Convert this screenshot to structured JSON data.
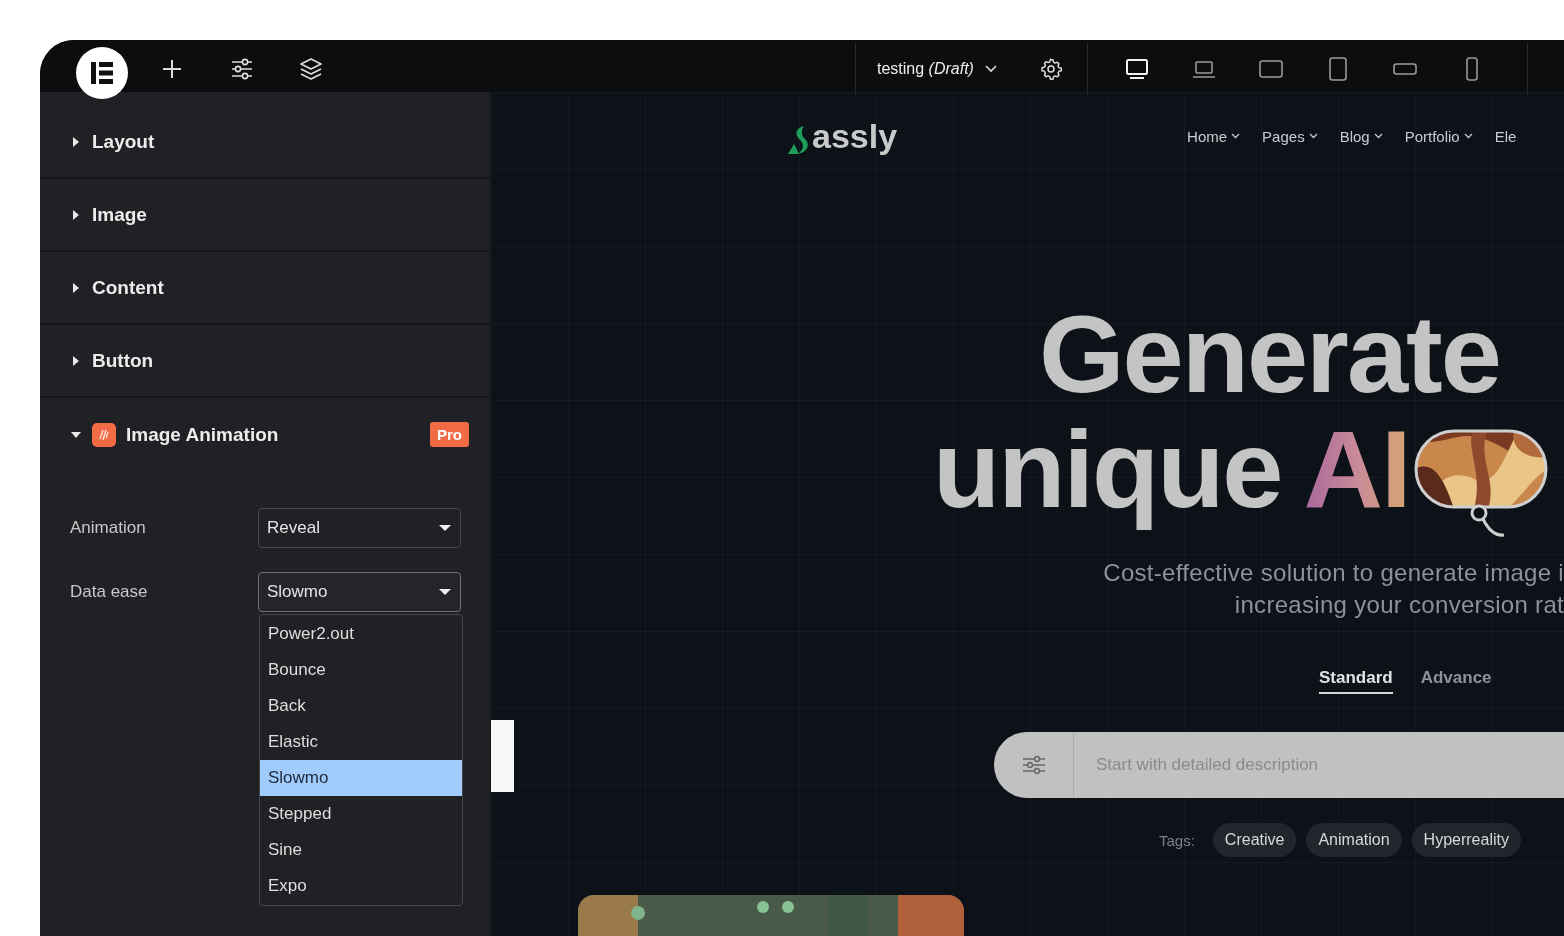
{
  "topbar": {
    "document": {
      "title": "testing",
      "status": "(Draft)"
    },
    "devices": [
      {
        "kind": "desktop",
        "selected": true
      },
      {
        "kind": "laptop",
        "selected": false
      },
      {
        "kind": "tablet-landscape",
        "selected": false
      },
      {
        "kind": "tablet",
        "selected": false
      },
      {
        "kind": "mobile-landscape",
        "selected": false
      },
      {
        "kind": "mobile",
        "selected": false
      }
    ]
  },
  "panel": {
    "sections": [
      {
        "title": "Layout",
        "expanded": false
      },
      {
        "title": "Image",
        "expanded": false
      },
      {
        "title": "Content",
        "expanded": false
      },
      {
        "title": "Button",
        "expanded": false
      },
      {
        "title": "Image Animation",
        "expanded": true,
        "badge": "Pro"
      }
    ],
    "controls": [
      {
        "label": "Animation",
        "value": "Reveal",
        "open": false
      },
      {
        "label": "Data ease",
        "value": "Slowmo",
        "open": true,
        "options": [
          {
            "label": "Power2.out",
            "selected": false
          },
          {
            "label": "Bounce",
            "selected": false
          },
          {
            "label": "Back",
            "selected": false
          },
          {
            "label": "Elastic",
            "selected": false
          },
          {
            "label": "Slowmo",
            "selected": true
          },
          {
            "label": "Stepped",
            "selected": false
          },
          {
            "label": "Sine",
            "selected": false
          },
          {
            "label": "Expo",
            "selected": false
          }
        ]
      }
    ]
  },
  "site": {
    "logo": "assly",
    "nav": [
      {
        "label": "Home",
        "submenu": true
      },
      {
        "label": "Pages",
        "submenu": true
      },
      {
        "label": "Blog",
        "submenu": true
      },
      {
        "label": "Portfolio",
        "submenu": true
      },
      {
        "label": "Ele",
        "submenu": false
      }
    ],
    "headline": {
      "line_1": "Generate",
      "line_2": "unique",
      "highlight": "AI"
    },
    "subtitle": [
      "Cost-effective solution to generate image i",
      "increasing your conversion rat"
    ],
    "modes": [
      {
        "label": "Standard",
        "selected": true
      },
      {
        "label": "Advance",
        "selected": false
      }
    ],
    "prompt": {
      "placeholder": "Start with detailed description"
    },
    "tags": {
      "label": "Tags:",
      "items": [
        "Creative",
        "Animation",
        "Hyperreality"
      ]
    }
  }
}
